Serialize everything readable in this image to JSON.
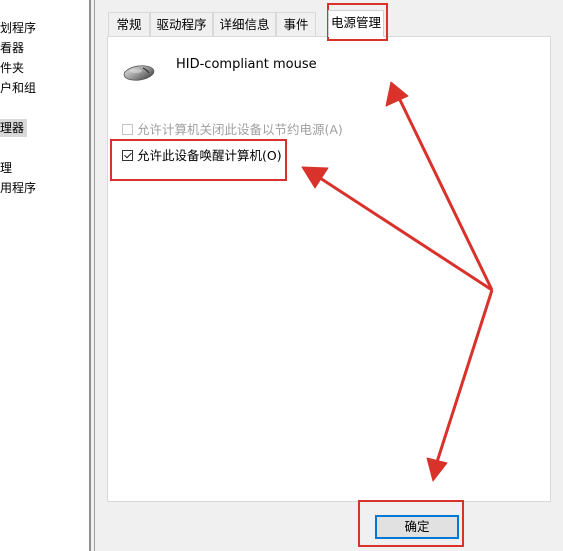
{
  "left_tree": {
    "items": [
      {
        "label": "划程序"
      },
      {
        "label": "看器"
      },
      {
        "label": "件夹"
      },
      {
        "label": "户和组"
      },
      {
        "label": "理器"
      },
      {
        "label": "理"
      },
      {
        "label": "用程序"
      }
    ]
  },
  "dialog": {
    "tabs": [
      {
        "label": "常规"
      },
      {
        "label": "驱动程序"
      },
      {
        "label": "详细信息"
      },
      {
        "label": "事件"
      },
      {
        "label": "电源管理"
      }
    ],
    "active_tab": "电源管理",
    "device": {
      "name": "HID-compliant mouse",
      "icon": "mouse-icon"
    },
    "options": [
      {
        "label": "允许计算机关闭此设备以节约电源(A)",
        "checked": false,
        "disabled": true
      },
      {
        "label": "允许此设备唤醒计算机(O)",
        "checked": true,
        "disabled": false
      }
    ],
    "ok_label": "确定"
  },
  "colors": {
    "annotation_red": "#d8322b",
    "focus_blue": "#0078d7"
  }
}
